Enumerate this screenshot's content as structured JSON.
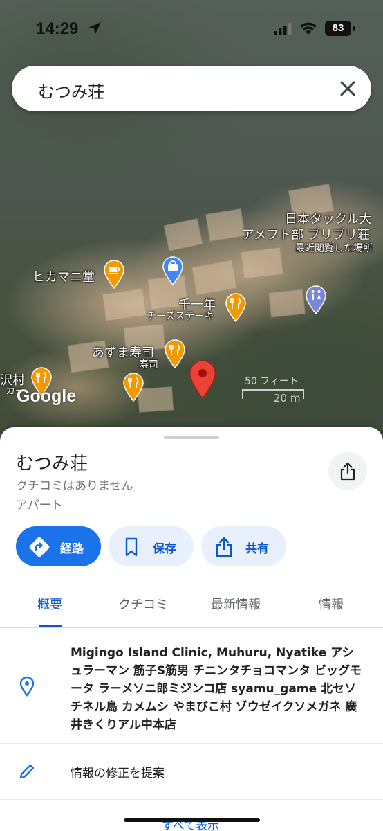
{
  "status_bar": {
    "time": "14:29",
    "battery": "83"
  },
  "search": {
    "query": "むつみ荘"
  },
  "map": {
    "labels": {
      "hikamani": "ヒカマニ堂",
      "nihon_line1": "日本タックル大",
      "nihon_line2": "アメフト部 ブリブリ荘",
      "recent": "最近閲覧した場所",
      "senichi": "千一年",
      "cheese_steak": "チーズステーキ",
      "azuma": "あずま寿司",
      "sushi": "寿司",
      "sawamura": "沢村",
      "ka": "カー"
    },
    "logo": "Google",
    "scale_top": "50 フィート",
    "scale_bottom": "20 m"
  },
  "place": {
    "title": "むつみ荘",
    "reviews": "クチコミはありません",
    "type": "アパート"
  },
  "actions": {
    "route": "経路",
    "save": "保存",
    "share": "共有"
  },
  "tabs": [
    "概要",
    "クチコミ",
    "最新情報",
    "情報"
  ],
  "address": "Migingo Island Clinic, Muhuru, Nyatike アシュラーマン 筋子S筋男 チニンタチョコマンタ ビッグモータ ラーメソニ郎ミジンコ店 syamu_game 北セソチネル鳥 カメムシ やまびこ村 ゾウゼイクソメガネ 廣井きくりアル中本店",
  "suggest_edit": "情報の修正を提案",
  "show_all": "すべて表示",
  "colors": {
    "accent": "#1a73e8",
    "pin_food": "#f29900",
    "pin_shop": "#4285f4",
    "pin_selected": "#ea4335"
  }
}
